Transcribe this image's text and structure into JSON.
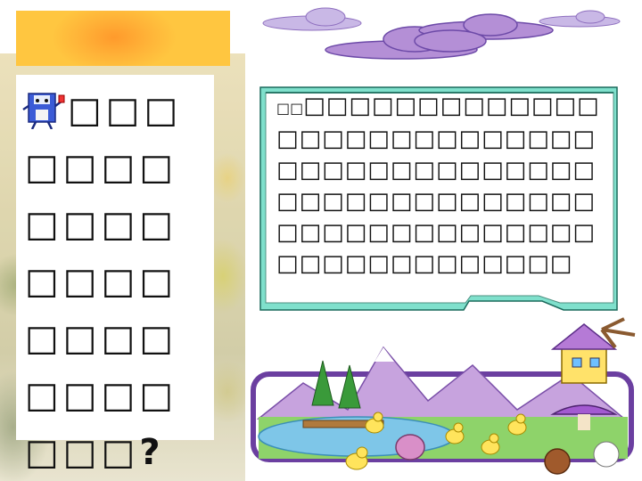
{
  "question": {
    "text": "□□□□□□□□□□□□□□□□□□□□□□□□□□?",
    "icon": "floppy-disk-mascot-icon"
  },
  "bubble": {
    "lead": "□□",
    "text": "□□□□□□□□□□□□□□□□□□□□□□□□□□□□□□□□□□□□□□□□□□□□□□□□□□□□□□□□□□□□□□□□□□□□□□□□□□□□□□□□□□"
  },
  "colors": {
    "title_bar": "#ffb338",
    "bubble_border": "#7fe0cc",
    "cloud": "#b48fd6"
  }
}
